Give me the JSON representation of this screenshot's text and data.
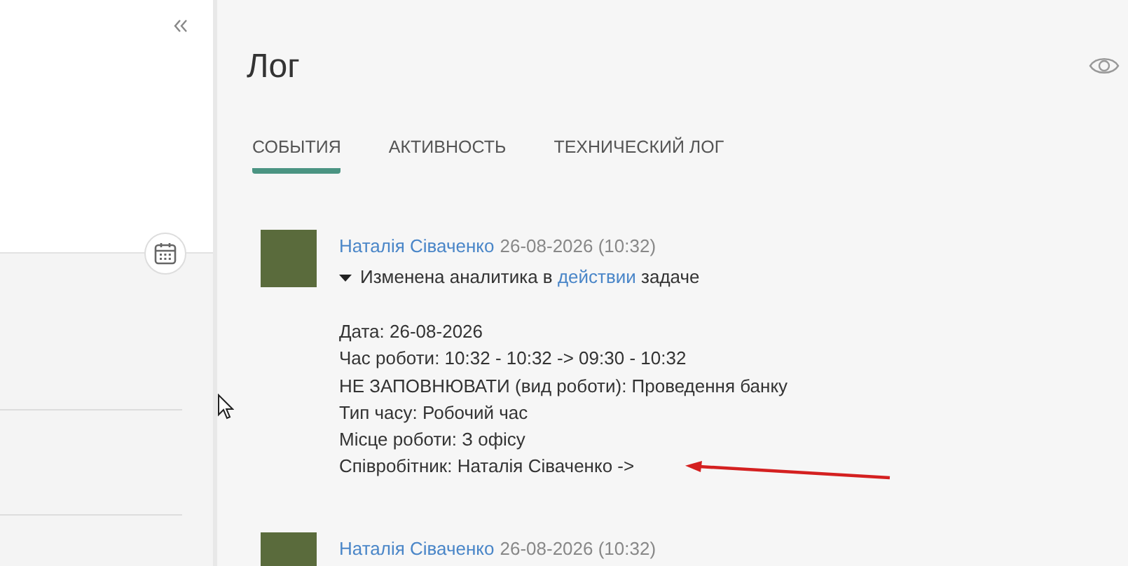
{
  "log": {
    "title": "Лог",
    "tabs": [
      {
        "label": "СОБЫТИЯ",
        "selected": true
      },
      {
        "label": "АКТИВНОСТЬ",
        "selected": false
      },
      {
        "label": "ТЕХНИЧЕСКИЙ ЛОГ",
        "selected": false
      }
    ],
    "entries": [
      {
        "author": "Наталія Сіваченко",
        "timestamp": "26-08-2026 (10:32)",
        "expanded": true,
        "summary_before": "Изменена аналитика в",
        "summary_link": "действии",
        "summary_after": "задаче",
        "details": [
          "Дата: 26-08-2026",
          "Час роботи: 10:32 - 10:32 -> 09:30 - 10:32",
          "НЕ ЗАПОВНЮВАТИ (вид роботи): Проведення банку",
          "Тип часу: Робочий час",
          "Місце роботи: З офісу",
          "Співробітник: Наталія Сіваченко ->"
        ]
      },
      {
        "author": "Наталія Сіваченко",
        "timestamp": "26-08-2026 (10:32)"
      }
    ]
  }
}
